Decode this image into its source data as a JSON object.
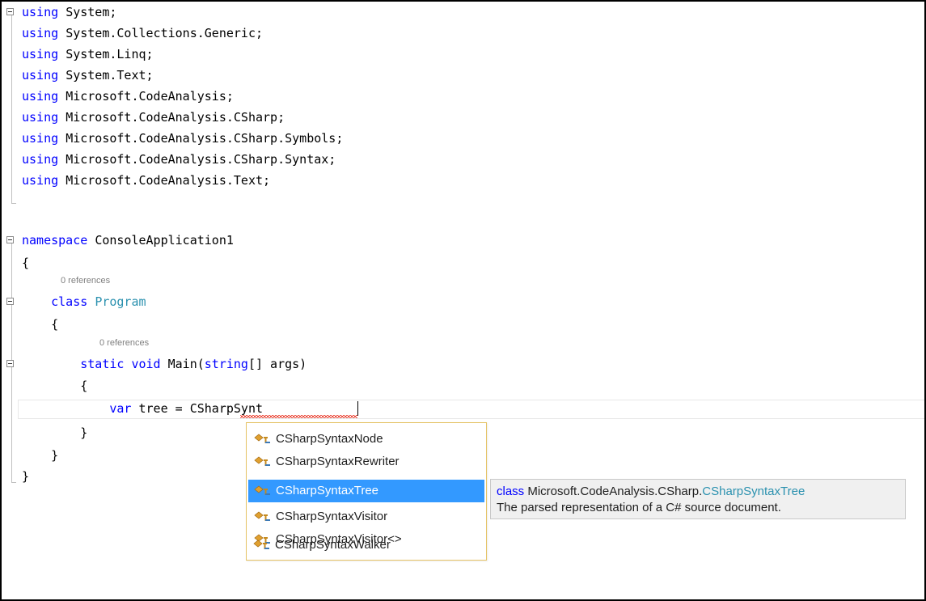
{
  "editor": {
    "usings": [
      {
        "kw": "using",
        "ns": "System;"
      },
      {
        "kw": "using",
        "ns": "System.Collections.Generic;"
      },
      {
        "kw": "using",
        "ns": "System.Linq;"
      },
      {
        "kw": "using",
        "ns": "System.Text;"
      },
      {
        "kw": "using",
        "ns": "Microsoft.CodeAnalysis;"
      },
      {
        "kw": "using",
        "ns": "Microsoft.CodeAnalysis.CSharp;"
      },
      {
        "kw": "using",
        "ns": "Microsoft.CodeAnalysis.CSharp.Symbols;"
      },
      {
        "kw": "using",
        "ns": "Microsoft.CodeAnalysis.CSharp.Syntax;"
      },
      {
        "kw": "using",
        "ns": "Microsoft.CodeAnalysis.Text;"
      }
    ],
    "namespace_kw": "namespace",
    "namespace_name": "ConsoleApplication1",
    "open_brace": "{",
    "close_brace": "}",
    "class_lens": "0 references",
    "class_kw": "class",
    "class_name": "Program",
    "method_lens": "0 references",
    "method_static": "static",
    "method_void": "void",
    "method_name_pre": "Main(",
    "method_param_type": "string",
    "method_name_post": "[] args)",
    "var_kw": "var",
    "var_rest": "tree = ",
    "typed_text": "CSharpSynt"
  },
  "completion": {
    "items": [
      {
        "label": "CSharpSyntaxNode",
        "icon": "class-icon"
      },
      {
        "label": "CSharpSyntaxRewriter",
        "icon": "class-icon"
      },
      {
        "label": "CSharpSyntaxTree",
        "icon": "class-icon",
        "selected": true
      },
      {
        "label": "CSharpSyntaxVisitor",
        "icon": "class-icon"
      },
      {
        "label": "CSharpSyntaxVisitor<>",
        "icon": "class-icon"
      },
      {
        "label": "CSharpSyntaxWalker",
        "icon": "class-icon"
      }
    ]
  },
  "tooltip": {
    "kw": "class",
    "ns": "Microsoft.CodeAnalysis.CSharp.",
    "type": "CSharpSyntaxTree",
    "description": "The parsed representation of a C# source document."
  },
  "colors": {
    "keyword": "#0000ff",
    "type": "#2b91af",
    "selection": "#3399ff",
    "popup_border": "#e5c365",
    "squiggle": "#e51400"
  }
}
